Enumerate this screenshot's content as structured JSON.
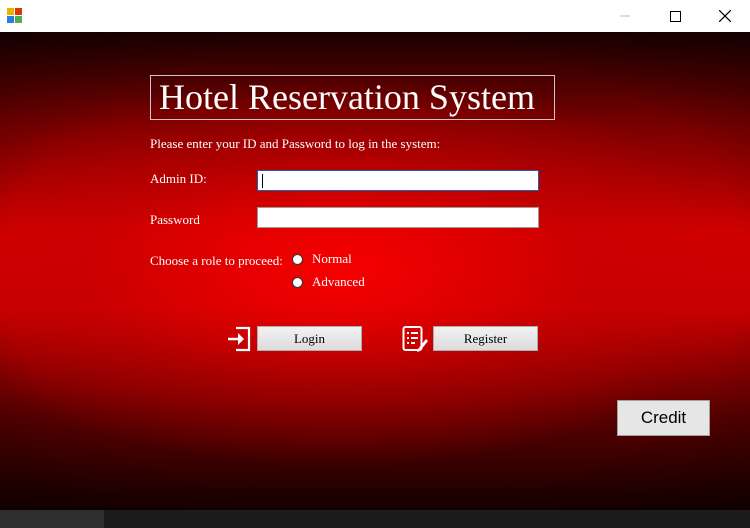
{
  "window": {
    "icons": {
      "app": "app-icon",
      "minimize": "minimize-icon",
      "maximize": "maximize-icon",
      "close": "close-icon"
    }
  },
  "form": {
    "title": "Hotel Reservation System",
    "instruction": "Please enter your ID and Password to log in the system:",
    "admin_id_label": "Admin ID:",
    "admin_id_value": "",
    "password_label": "Password",
    "password_value": "",
    "role_label": "Choose a role to proceed:",
    "roles": [
      {
        "label": "Normal",
        "selected": false
      },
      {
        "label": "Advanced",
        "selected": false
      }
    ],
    "login_label": "Login",
    "register_label": "Register",
    "credit_label": "Credit",
    "icons": {
      "login": "login-icon",
      "register": "register-icon"
    }
  },
  "colors": {
    "background": "#d00000",
    "text": "#ffffff",
    "focus_border": "#1c5fb0"
  }
}
